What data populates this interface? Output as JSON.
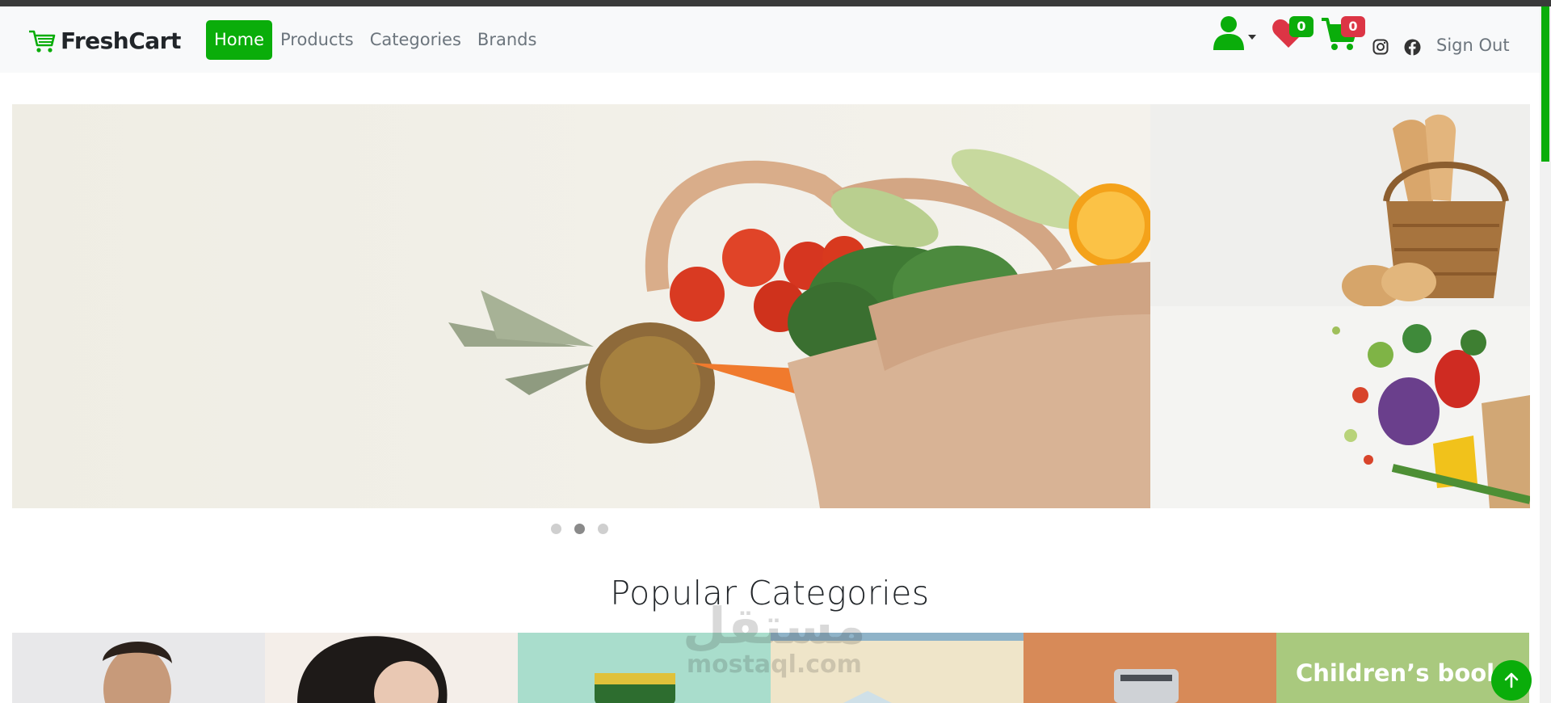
{
  "brand": {
    "name": "FreshCart"
  },
  "nav": {
    "links": [
      {
        "label": "Home",
        "active": true
      },
      {
        "label": "Products",
        "active": false
      },
      {
        "label": "Categories",
        "active": false
      },
      {
        "label": "Brands",
        "active": false
      }
    ],
    "wishlist_count": "0",
    "cart_count": "0",
    "signout_label": "Sign Out",
    "icons": [
      "user-icon",
      "heart-icon",
      "cart-icon",
      "instagram-icon",
      "facebook-icon"
    ]
  },
  "hero": {
    "main_slide": "grocery-bag",
    "side_slides": [
      "bread-basket",
      "vegetables"
    ],
    "dots": 3,
    "active_dot": 1
  },
  "categories": {
    "title": "Popular Categories",
    "items": [
      {
        "label": ""
      },
      {
        "label": ""
      },
      {
        "label": ""
      },
      {
        "label": ""
      },
      {
        "label": ""
      },
      {
        "label": "Children’s book"
      }
    ]
  },
  "watermark": {
    "arabic": "مستقل",
    "latin": "mostaql.com"
  },
  "colors": {
    "accent": "#0aad0a",
    "danger": "#dc3545",
    "text_muted": "#6c757d",
    "nav_bg": "#f8f9fa"
  }
}
